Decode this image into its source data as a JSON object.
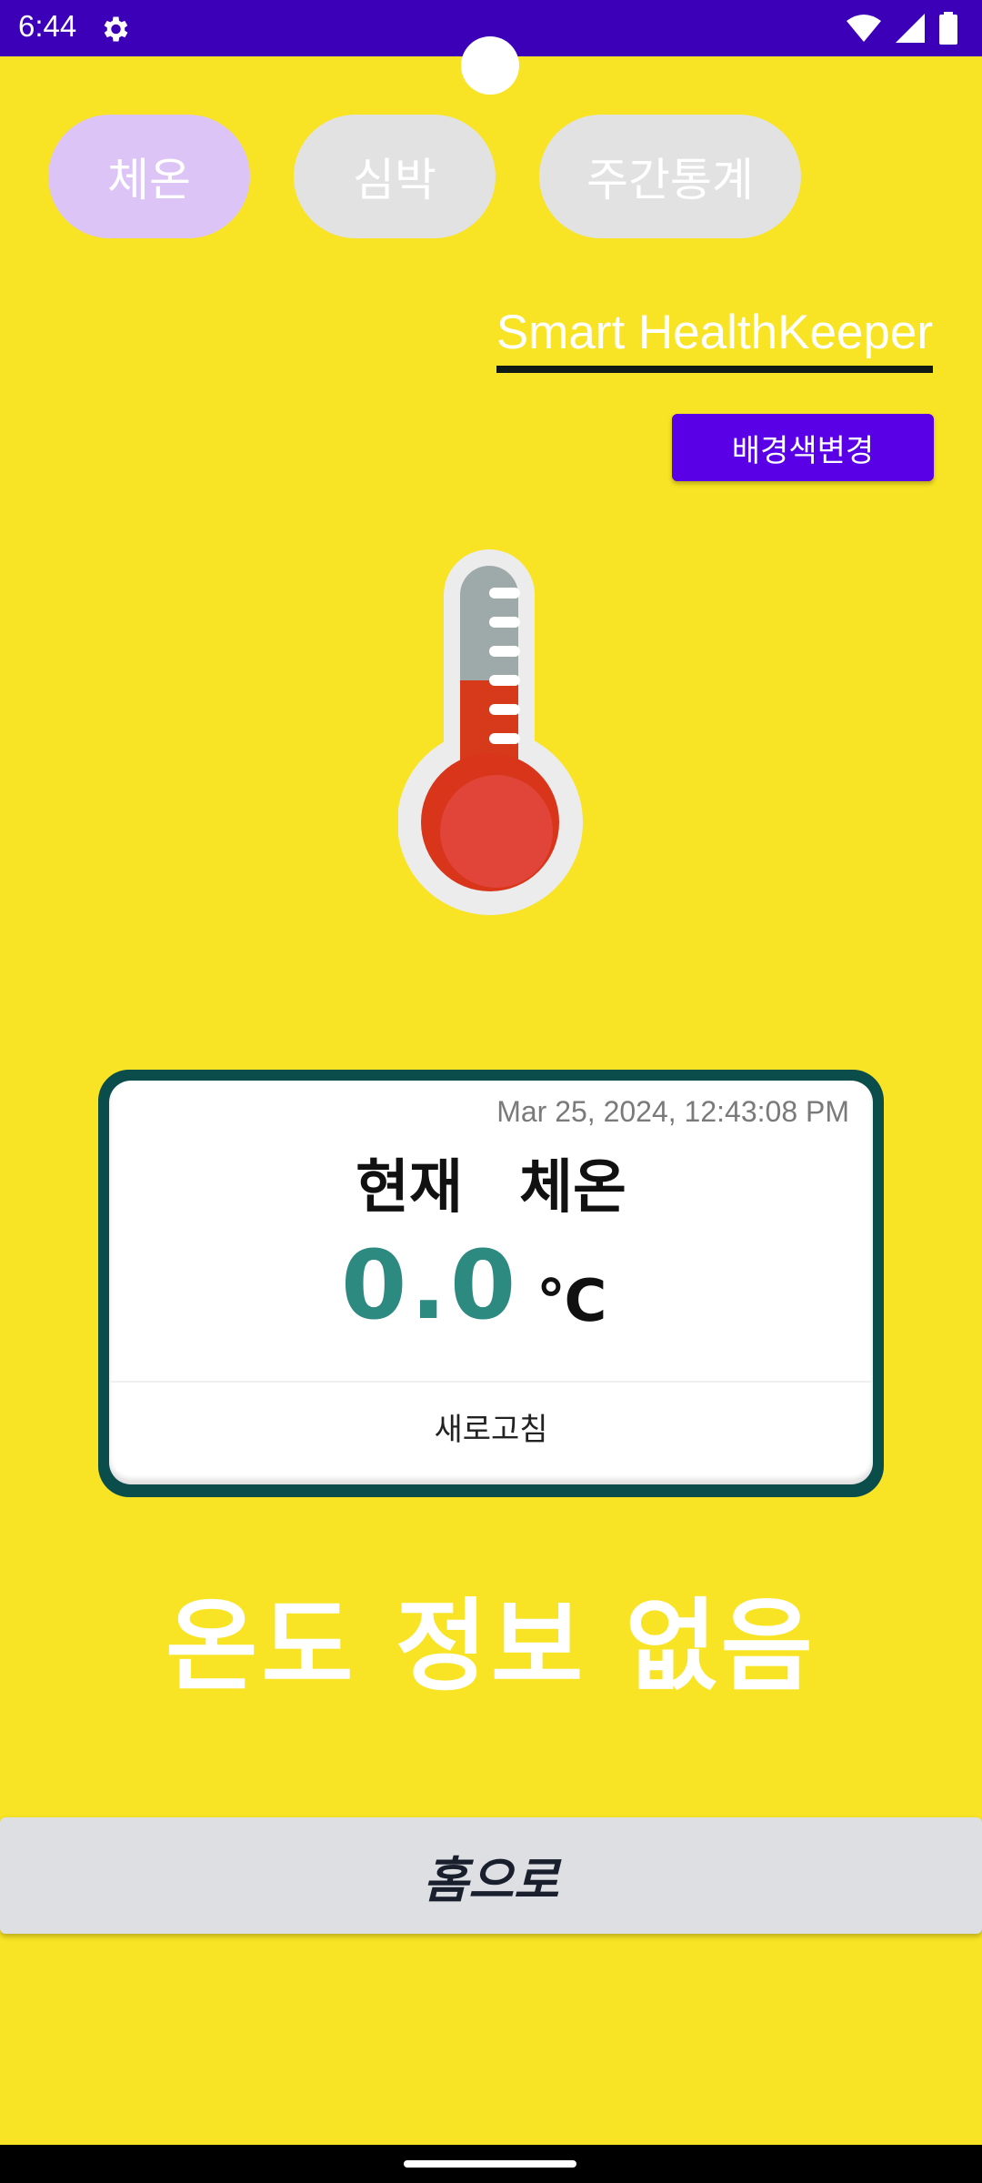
{
  "status_bar": {
    "time": "6:44",
    "icons": [
      "settings-gear-icon",
      "wifi-icon",
      "signal-icon",
      "battery-icon"
    ]
  },
  "tabs": [
    {
      "label": "체온",
      "active": true
    },
    {
      "label": "심박",
      "active": false
    },
    {
      "label": "주간통계",
      "active": false
    }
  ],
  "app_title": "Smart HealthKeeper",
  "bg_change_label": "배경색변경",
  "thermometer_icon": "thermometer-icon",
  "card": {
    "timestamp": "Mar 25, 2024, 12:43:08 PM",
    "heading": "현재 체온",
    "value": "0.0",
    "unit": "℃",
    "refresh_label": "새로고침"
  },
  "no_temp_message": "온도 정보 없음",
  "home_label": "홈으로",
  "colors": {
    "background": "#f8e424",
    "status_bar": "#3c00b8",
    "accent_button": "#5a00e6",
    "card_border": "#0a4d4a",
    "value_text": "#2d8a80",
    "active_tab": "#dcc4f6"
  }
}
